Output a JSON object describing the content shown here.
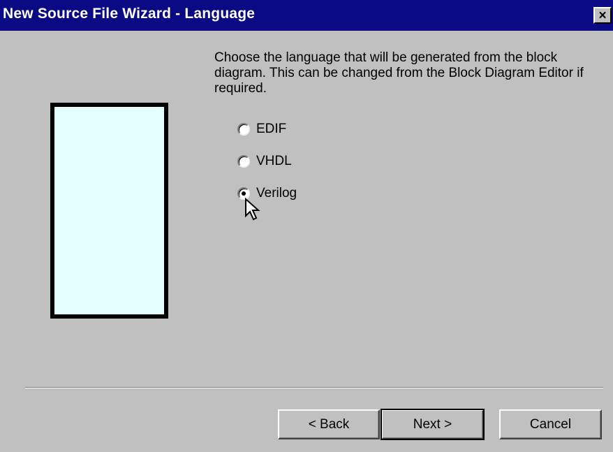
{
  "window": {
    "title": "New Source File Wizard - Language",
    "close_glyph": "×",
    "titlebar_color": "#0a0a84",
    "background_color": "#c0c0c0"
  },
  "preview": {
    "fill_color": "#e4ffff",
    "border_color": "#000000"
  },
  "description": "Choose the language that will be generated from the block diagram. This can be changed from the Block Diagram Editor if required.",
  "language_options": [
    {
      "label": "EDIF",
      "selected": false
    },
    {
      "label": "VHDL",
      "selected": false
    },
    {
      "label": "Verilog",
      "selected": true
    }
  ],
  "buttons": {
    "back": "< Back",
    "next": "Next >",
    "cancel": "Cancel"
  },
  "icons": {
    "close": "close-icon",
    "cursor": "mouse-pointer-icon"
  }
}
